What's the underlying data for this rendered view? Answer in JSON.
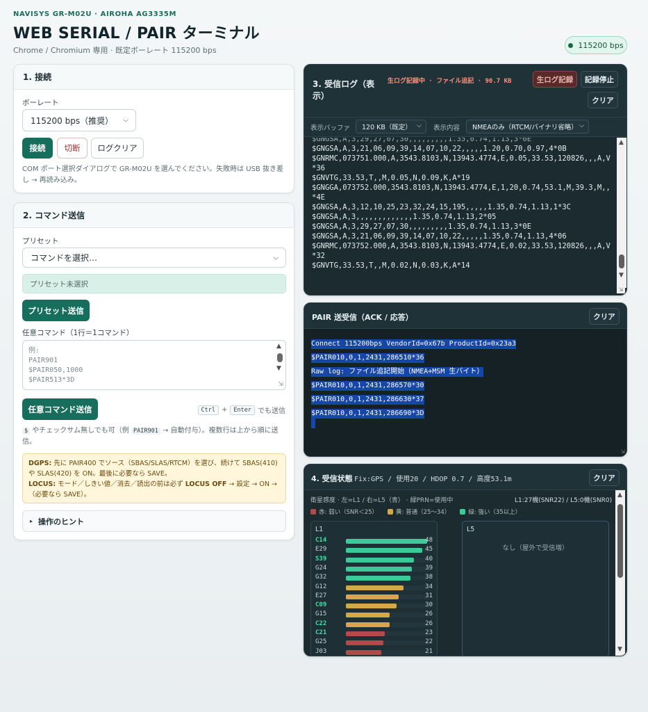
{
  "header": {
    "eyebrow": "NAVISYS GR-M02U · AIROHA AG3335M",
    "title": "WEB SERIAL / PAIR ターミナル",
    "subtitle": "Chrome / Chromium 専用 · 既定ボーレート 115200 bps",
    "baud_pill": "115200 bps"
  },
  "connect": {
    "title": "1. 接続",
    "baud_label": "ボーレート",
    "baud_value": "115200 bps（推奨）",
    "connect_label": "接続",
    "disconnect_label": "切断",
    "clear_log_label": "ログクリア",
    "help": "COM ポート選択ダイアログで GR-M02U を選んでください。失敗時は USB 抜き差し → 再読み込み。"
  },
  "command": {
    "title": "2. コマンド送信",
    "preset_label": "プリセット",
    "preset_value": "コマンドを選択…",
    "preset_status": "プリセット未選択",
    "preset_send_label": "プリセット送信",
    "custom_label": "任意コマンド（1行＝1コマンド）",
    "custom_placeholder": "例:\nPAIR901\n$PAIR050,1000\n$PAIR513*3D",
    "custom_send_label": "任意コマンド送信",
    "shortcut_ctrl": "Ctrl",
    "shortcut_plus": "+",
    "shortcut_enter": "Enter",
    "shortcut_suffix": "でも送信",
    "note_dollar": "$",
    "note_text1": "やチェックサム無しでも可（例",
    "note_example": "PAIR901",
    "note_text2": "→ 自動付与）。複数行は上から順に送信。",
    "dgps_label": "DGPS:",
    "dgps_text": "先に PAIR400 でソース（SBAS/SLAS/RTCM）を選び、続けて SBAS(410) や SLAS(420) を ON。最後に必要なら SAVE。",
    "locus_label": "LOCUS:",
    "locus_text1": "モード／しきい値／消去／読出の前は必ず",
    "locus_bold": "LOCUS OFF",
    "locus_text2": "→ 設定 → ON →（必要なら SAVE）。",
    "hints_label": "操作のヒント"
  },
  "rxlog": {
    "title_line1": "3. 受信ログ（表",
    "title_line2": "示）",
    "status": "生ログ記録中 · ファイル追記 · 90.7 KB",
    "rawlog_label": "生ログ記録",
    "stoprec_label": "記録停止",
    "clear_label": "クリア",
    "buffer_label": "表示バッファ",
    "buffer_value": "120 KB（既定）",
    "content_label": "表示内容",
    "content_value": "NMEAのみ（RTCM/バイナリ省略）",
    "lines": [
      "$GNGSA,A,3,21,06,09,39,14,07,10,22,,,,,1.20,0.70,0.97,4*0B",
      "$GNRMC,073751.000,A,3543.8103,N,13943.4774,E,0.05,33.53,120826,,,A,V",
      "*36",
      "$GNVTG,33.53,T,,M,0.05,N,0.09,K,A*19",
      "$GNGGA,073752.000,3543.8103,N,13943.4774,E,1,20,0.74,53.1,M,39.3,M,,",
      "*4E",
      "$GNGSA,A,3,12,10,25,23,32,24,15,195,,,,,1.35,0.74,1.13,1*3C",
      "$GNGSA,A,3,,,,,,,,,,,,,1.35,0.74,1.13,2*05",
      "$GNGSA,A,3,29,27,07,30,,,,,,,,,1.35,0.74,1.13,3*0E",
      "$GNGSA,A,3,21,06,09,39,14,07,10,22,,,,,1.35,0.74,1.13,4*06",
      "$GNRMC,073752.000,A,3543.8103,N,13943.4774,E,0.02,33.53,120826,,,A,V",
      "*32",
      "$GNVTG,33.53,T,,M,0.02,N,0.03,K,A*14"
    ]
  },
  "pair": {
    "title": "PAIR 送受信（ACK / 応答）",
    "clear_label": "クリア",
    "lines": [
      "Connect 115200bps VendorId=0x67b ProductId=0x23a3",
      "$PAIR010,0,1,2431,286510*36",
      "Raw log: ファイル追記開始（NMEA+MSM 生バイト）",
      "$PAIR010,0,1,2431,286570*30",
      "$PAIR010,0,1,2431,286630*37",
      "$PAIR010,0,1,2431,286690*3D"
    ]
  },
  "status": {
    "title": "4. 受信状態",
    "summary": "Fix:GPS / 使用20 / HDOP 0.7 / 高度53.1m",
    "clear_label": "クリア",
    "sensitivity_caption": "衛星感度 · 左=L1 / 右=L5（青） · 緑PRN=使用中",
    "counts": "L1:27機(SNR22) / L5:0機(SNR0)",
    "legend": [
      {
        "label": "赤: 弱い（SNR＜25）",
        "color": "#b24a4a"
      },
      {
        "label": "黄: 普通（25〜34）",
        "color": "#d4a84a"
      },
      {
        "label": "緑: 強い（35以上）",
        "color": "#3ec99a"
      }
    ],
    "l1_label": "L1",
    "l5_label": "L5",
    "l5_empty": "なし（屋外で受信増）",
    "snr_max": 50,
    "satellites": [
      {
        "id": "C14",
        "snr": 48,
        "used": true
      },
      {
        "id": "E29",
        "snr": 45,
        "used": false
      },
      {
        "id": "S39",
        "snr": 40,
        "used": true
      },
      {
        "id": "G24",
        "snr": 39,
        "used": false
      },
      {
        "id": "G32",
        "snr": 38,
        "used": false
      },
      {
        "id": "G12",
        "snr": 34,
        "used": false
      },
      {
        "id": "E27",
        "snr": 31,
        "used": false
      },
      {
        "id": "C09",
        "snr": 30,
        "used": true
      },
      {
        "id": "G15",
        "snr": 26,
        "used": false
      },
      {
        "id": "C22",
        "snr": 26,
        "used": true
      },
      {
        "id": "C21",
        "snr": 23,
        "used": true
      },
      {
        "id": "G25",
        "snr": 22,
        "used": false
      },
      {
        "id": "J03",
        "snr": 21,
        "used": false
      }
    ]
  }
}
